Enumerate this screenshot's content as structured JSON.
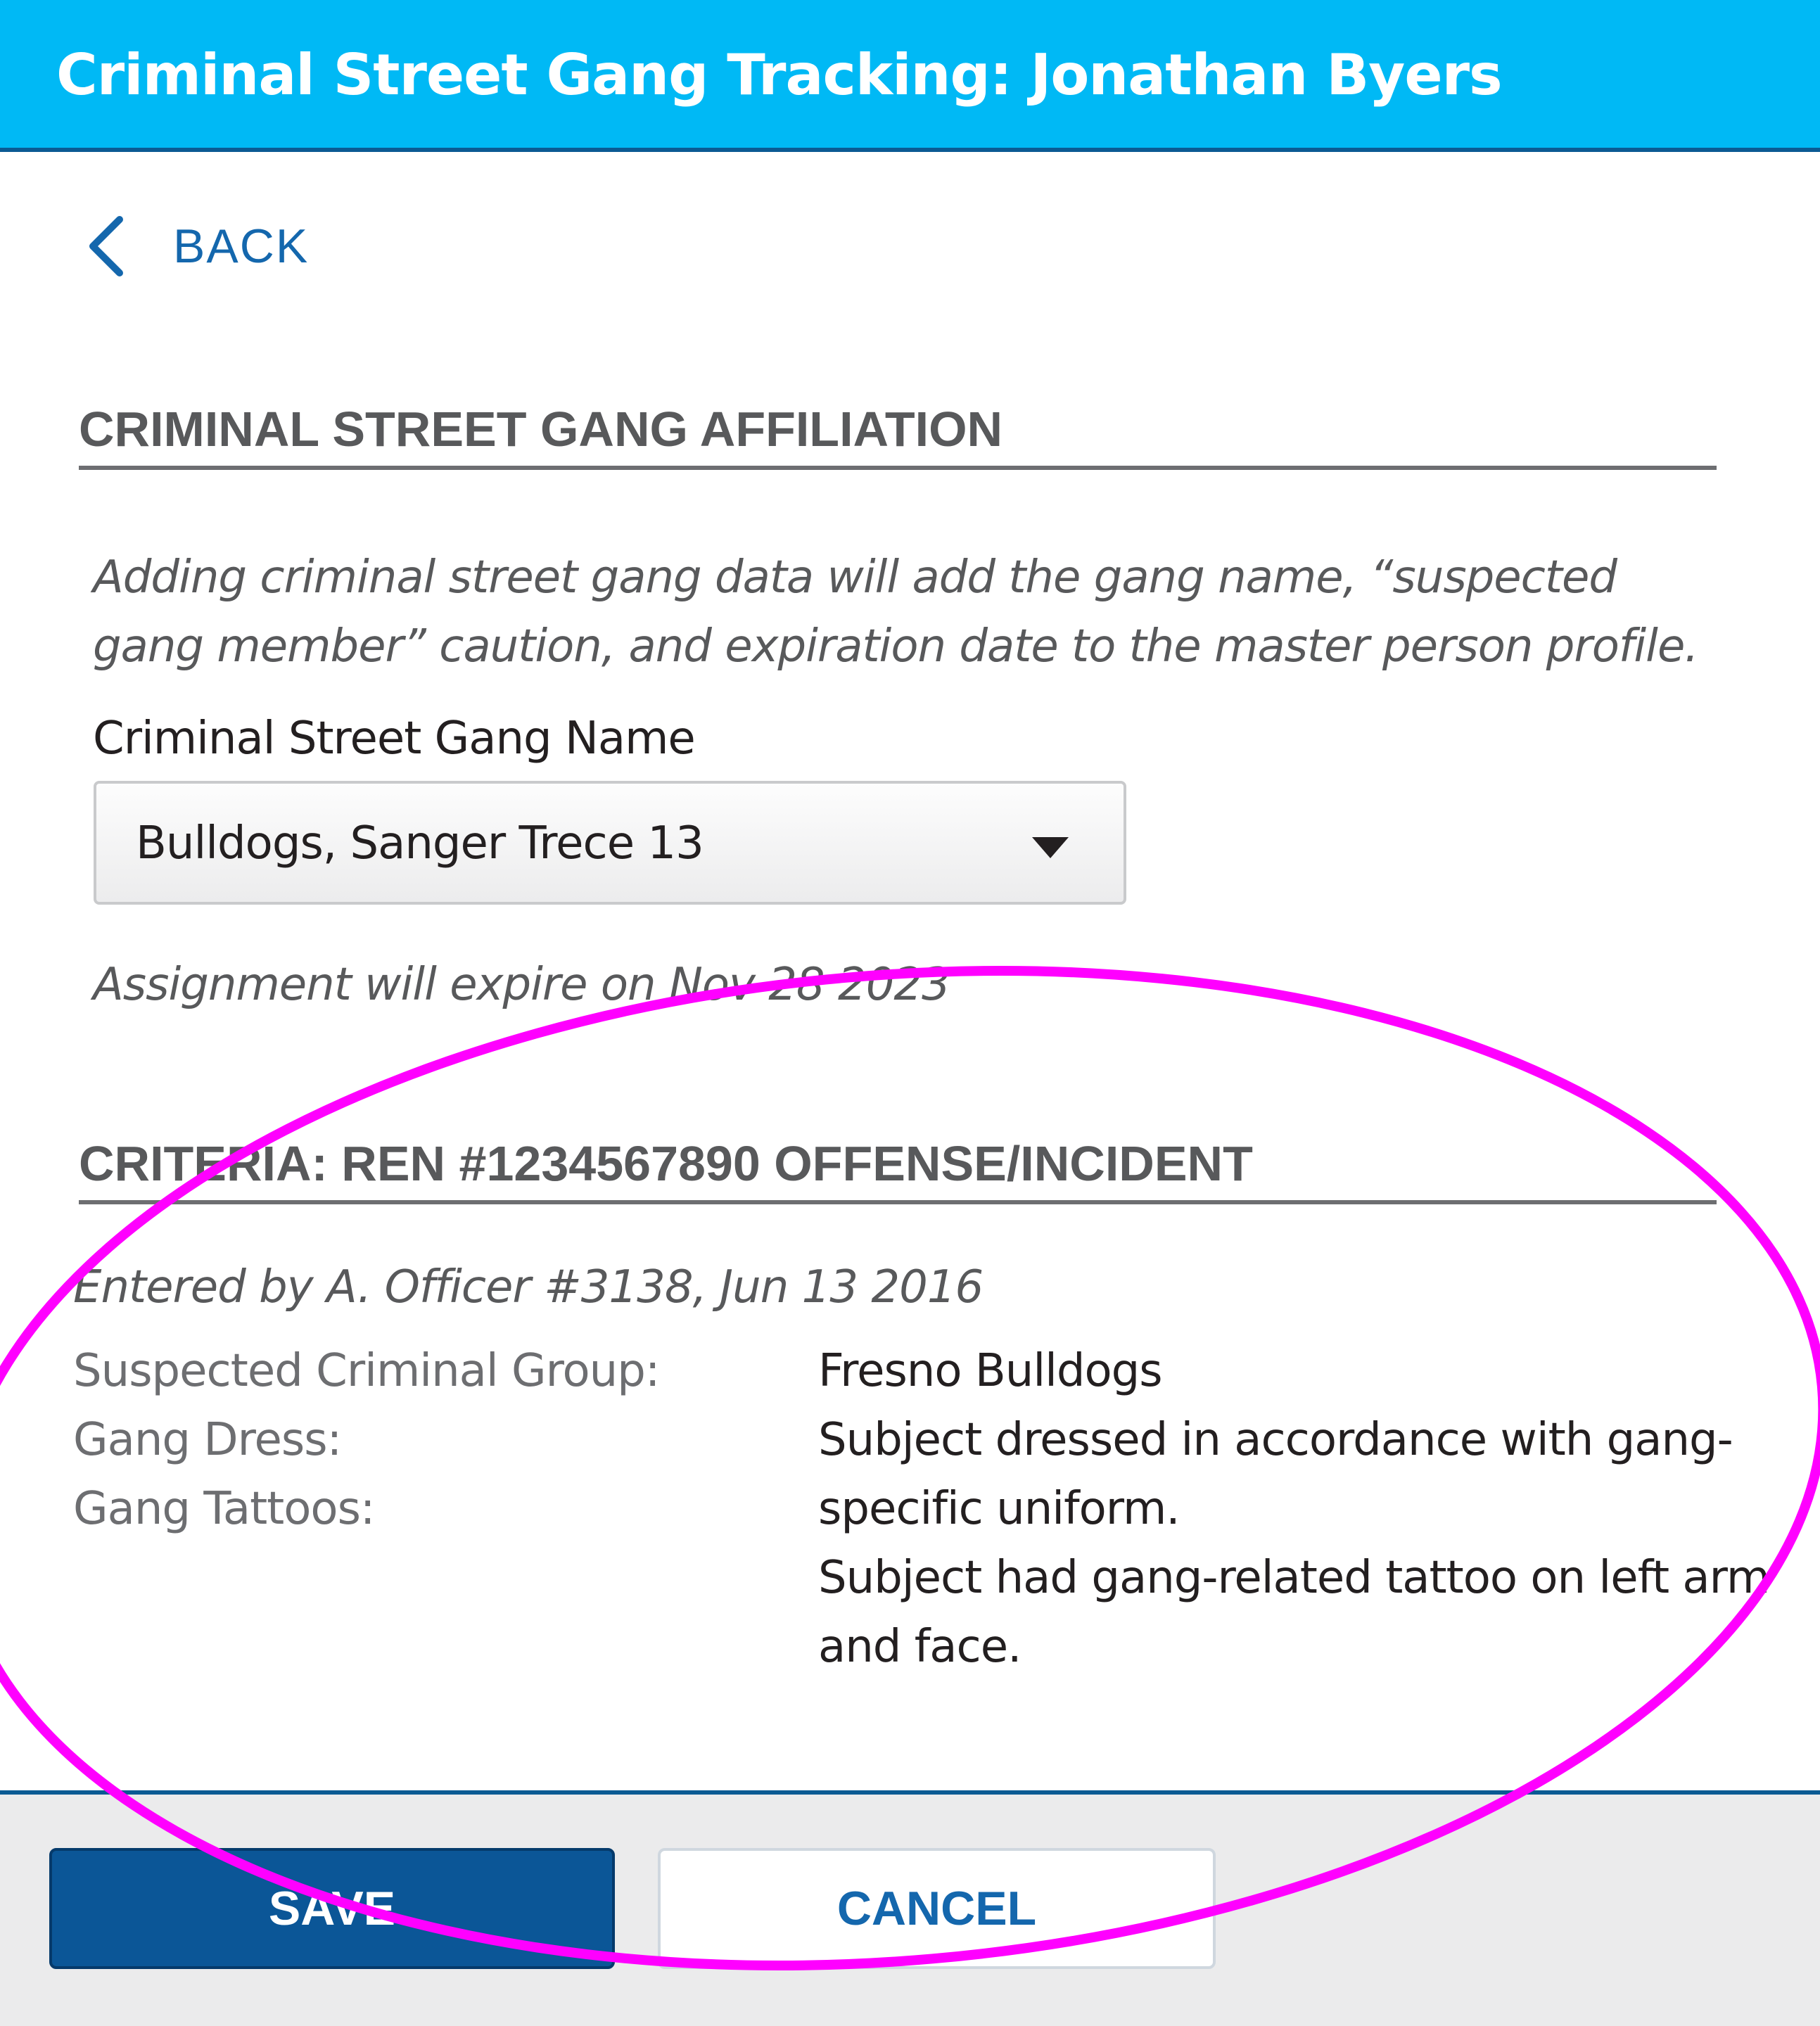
{
  "header": {
    "title": "Criminal Street Gang Tracking: Jonathan Byers"
  },
  "nav": {
    "back_label": "BACK"
  },
  "affiliation": {
    "heading": "CRIMINAL STREET GANG AFFILIATION",
    "intro": "Adding criminal street gang data will add the gang name, “suspected gang member” caution, and expiration date to the master person profile.",
    "field_label": "Criminal Street Gang Name",
    "selected_gang": "Bulldogs, Sanger Trece 13",
    "expiration_text": "Assignment will expire on Nov 28 2023"
  },
  "criteria": {
    "heading": "CRITERIA: REN #1234567890 OFFENSE/INCIDENT",
    "entered_by": "Entered by A. Officer #3138, Jun 13 2016",
    "labels": [
      "Suspected Criminal Group:",
      "Gang Dress:",
      "Gang Tattoos:"
    ],
    "values": [
      "Fresno Bulldogs",
      "Subject dressed in accordance with gang-specific uniform.",
      "Subject had gang-related tattoo on left arm and face."
    ]
  },
  "footer": {
    "save_label": "SAVE",
    "cancel_label": "CANCEL"
  },
  "colors": {
    "header_bg": "#00b9f5",
    "accent_dark": "#0b5697",
    "link": "#1467ad",
    "annotation": "#ff00ff"
  },
  "icons": {
    "back": "chevron-left-icon",
    "dropdown": "caret-down-icon"
  }
}
